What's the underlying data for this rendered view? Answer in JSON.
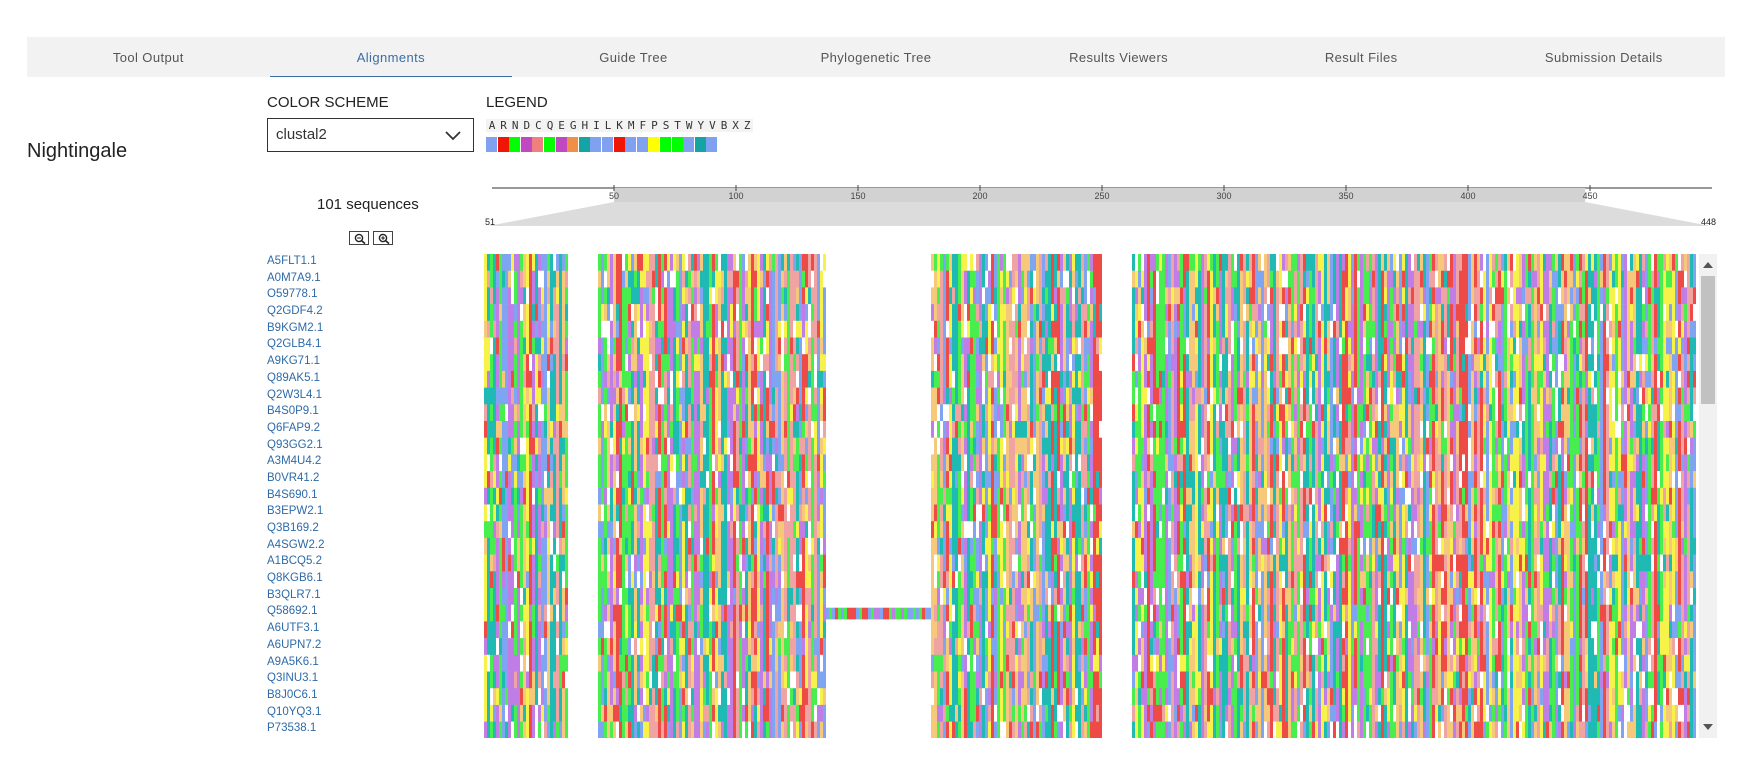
{
  "tabs": [
    {
      "label": "Tool Output",
      "active": false
    },
    {
      "label": "Alignments",
      "active": true
    },
    {
      "label": "Guide Tree",
      "active": false
    },
    {
      "label": "Phylogenetic Tree",
      "active": false
    },
    {
      "label": "Results Viewers",
      "active": false
    },
    {
      "label": "Result Files",
      "active": false
    },
    {
      "label": "Submission Details",
      "active": false
    }
  ],
  "section_title": "Nightingale",
  "color_scheme": {
    "label": "COLOR SCHEME",
    "value": "clustal2"
  },
  "legend": {
    "label": "LEGEND",
    "letters": [
      "A",
      "R",
      "N",
      "D",
      "C",
      "Q",
      "E",
      "G",
      "H",
      "I",
      "L",
      "K",
      "M",
      "F",
      "P",
      "S",
      "T",
      "W",
      "Y",
      "V",
      "B",
      "X",
      "Z"
    ],
    "colors": [
      "#80a0f0",
      "#f01505",
      "#00ff00",
      "#c048c0",
      "#f08080",
      "#00ff00",
      "#c048c0",
      "#f09048",
      "#15a4a4",
      "#80a0f0",
      "#80a0f0",
      "#f01505",
      "#80a0f0",
      "#80a0f0",
      "#ffff00",
      "#00ff00",
      "#00ff00",
      "#80a0f0",
      "#15a4a4",
      "#80a0f0"
    ]
  },
  "sequence_count": "101 sequences",
  "navigation": {
    "ticks": [
      50,
      100,
      150,
      200,
      250,
      300,
      350,
      400,
      450
    ],
    "range_start": "51",
    "range_end": "448"
  },
  "sequences": [
    "A5FLT1.1",
    "A0M7A9.1",
    "O59778.1",
    "Q2GDF4.2",
    "B9KGM2.1",
    "Q2GLB4.1",
    "A9KG71.1",
    "Q89AK5.1",
    "Q2W3L4.1",
    "B4S0P9.1",
    "Q6FAP9.2",
    "Q93GG2.1",
    "A3M4U4.2",
    "B0VR41.2",
    "B4S690.1",
    "B3EPW2.1",
    "Q3B169.2",
    "A4SGW2.2",
    "A1BCQ5.2",
    "Q8KGB6.1",
    "B3QLR7.1",
    "Q58692.1",
    "A6UTF3.1",
    "A6UPN7.2",
    "A9A5K6.1",
    "Q3INU3.1",
    "B8J0C6.1",
    "Q10YQ3.1",
    "P73538.1"
  ],
  "alignment_palette": [
    "#7fa5f2",
    "#ef4b46",
    "#47ee4d",
    "#c07de6",
    "#f0a3a3",
    "#f7f24a",
    "#1fbab4",
    "#f5c87a"
  ]
}
